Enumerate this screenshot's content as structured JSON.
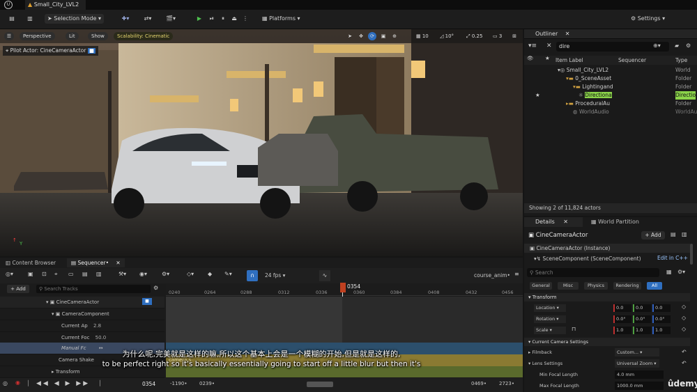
{
  "window": {
    "tab_title": "Small_City_LVL2"
  },
  "toolbar": {
    "selection_mode": "Selection Mode",
    "platforms": "Platforms",
    "settings": "Settings"
  },
  "viewport": {
    "perspective": "Perspective",
    "lit": "Lit",
    "show": "Show",
    "scalability": "Scalability: Cinematic",
    "grid": "10",
    "rotate": "10°",
    "scale": "0.25",
    "cam_speed": "3",
    "pilot": "Pilot Actor: CineCameraActor"
  },
  "outliner": {
    "title": "Outliner",
    "search": "dire",
    "col_label": "Item Label",
    "col_seq": "Sequencer",
    "col_type": "Type",
    "rows": [
      {
        "label": "Small_City_LVL2",
        "type": "World"
      },
      {
        "label": "0_SceneAsset",
        "type": "Folder"
      },
      {
        "label": "Lightingand",
        "type": "Folder"
      },
      {
        "label": "Directiona",
        "type": "Directio"
      },
      {
        "label": "ProceduralAu",
        "type": "Folder"
      },
      {
        "label": "WorldAudio",
        "type": "WorldAu"
      }
    ],
    "status": "Showing 2 of 11,824 actors"
  },
  "details": {
    "tab_details": "Details",
    "tab_wp": "World Partition",
    "actor": "CineCameraActor",
    "add": "+ Add",
    "instance": "CineCameraActor (Instance)",
    "component": "SceneComponent (SceneComponent)",
    "edit": "Edit in C++",
    "search": "Search",
    "filters": [
      "General",
      "Misc",
      "Physics",
      "Rendering",
      "All"
    ],
    "transform": "Transform",
    "location": {
      "label": "Location",
      "x": "0.0",
      "y": "0.0",
      "z": "0.0"
    },
    "rotation": {
      "label": "Rotation",
      "x": "0.0°",
      "y": "0.0°",
      "z": "0.0°"
    },
    "scale": {
      "label": "Scale",
      "x": "1.0",
      "y": "1.0",
      "z": "1.0"
    },
    "camera_settings": "Current Camera Settings",
    "filmback": "Filmback",
    "filmback_val": "Custom...",
    "lens": "Lens Settings",
    "lens_val": "Universal Zoom",
    "min_focal": "Min Focal Length",
    "min_focal_val": "4.0 mm",
    "max_focal": "Max Focal Length",
    "max_focal_val": "1000.0 mm"
  },
  "sequencer": {
    "tab_cb": "Content Browser",
    "tab_seq": "Sequencer•",
    "fps": "24 fps",
    "anim": "course_anim•",
    "add": "+ Add",
    "search": "Search Tracks",
    "playhead": "0354",
    "ruler": [
      "0240",
      "0264",
      "0288",
      "0312",
      "0336",
      "0360",
      "0384",
      "0408",
      "0432",
      "0456"
    ],
    "tracks": [
      {
        "label": "CineCameraActor",
        "val": ""
      },
      {
        "label": "CameraComponent",
        "val": ""
      },
      {
        "label": "Current Ap",
        "val": "2.8"
      },
      {
        "label": "Current Foc",
        "val": "50.0"
      },
      {
        "label": "Manual Fc",
        "val": ""
      },
      {
        "label": "Camera Shake",
        "val": ""
      },
      {
        "label": "Transform",
        "val": ""
      }
    ],
    "frame": "0354",
    "range_start": "-1190•",
    "range_in": "0239•",
    "range_out": "0469•",
    "range_end": "2723•",
    "shake_clip": "camera s"
  },
  "subtitle": {
    "zh": "为什么呢,完美就是这样的嘛,所以这个基本上会是一个模糊的开始,但是就是这样的,",
    "en": "to be perfect right so it's basically essentially going to start off a little blur but then it's"
  },
  "watermark": "ûdemy"
}
